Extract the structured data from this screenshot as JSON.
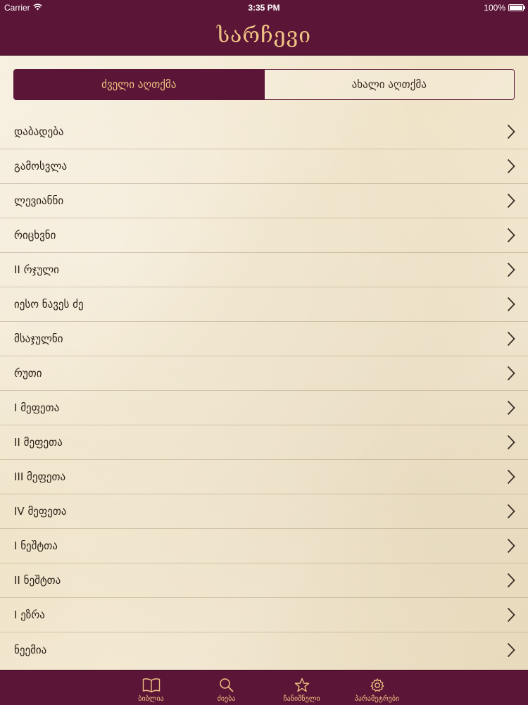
{
  "status_bar": {
    "carrier": "Carrier",
    "time": "3:35 PM",
    "battery": "100%"
  },
  "nav": {
    "title": "სარჩევი"
  },
  "segments": [
    {
      "label": "ძველი აღთქმა",
      "selected": true
    },
    {
      "label": "ახალი აღთქმა",
      "selected": false
    }
  ],
  "books": [
    "დაბადება",
    "გამოსვლა",
    "ლევიანნი",
    "რიცხვნი",
    "II რჯული",
    "იესო ნავეს ძე",
    "მსაჯულნი",
    "რუთი",
    "I მეფეთა",
    "II მეფეთა",
    "III მეფეთა",
    "IV მეფეთა",
    "I ნეშტთა",
    "II ნეშტთა",
    "I ეზრა",
    "ნეემია"
  ],
  "tab_bar": {
    "items": [
      {
        "label": "ბიბლია",
        "icon": "book-icon"
      },
      {
        "label": "ძიება",
        "icon": "search-icon"
      },
      {
        "label": "ჩანიშნული",
        "icon": "star-icon"
      },
      {
        "label": "პარამეტრები",
        "icon": "gear-icon"
      }
    ]
  },
  "colors": {
    "brand": "#5b1536",
    "accent": "#efc383",
    "background": "#f2e8d3"
  }
}
